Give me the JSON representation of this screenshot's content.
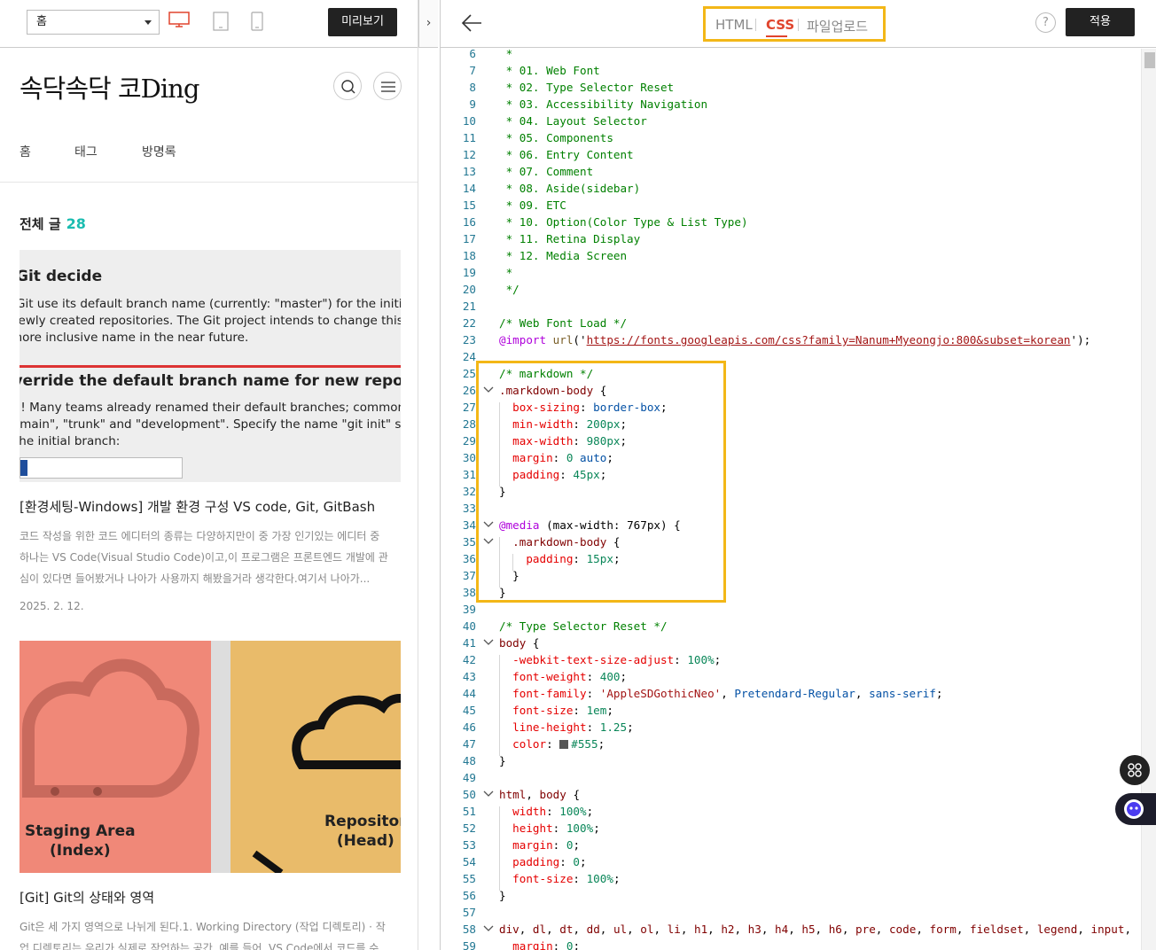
{
  "toolbar": {
    "page_select_value": "홈",
    "preview_label": "미리보기",
    "collapse_icon": "›"
  },
  "blog": {
    "title": "속닥속닥 코Ding",
    "nav": [
      "홈",
      "태그",
      "방명록"
    ],
    "all_posts_label": "전체 글",
    "all_posts_count": "28",
    "posts": [
      {
        "thumb_lines": {
          "h1": "Git decide",
          "p1": "Git use its default branch name (currently: \"master\") for the initia",
          "p2": "newly created repositories. The Git project intends to change this d",
          "p3": "more inclusive name in the near future.",
          "h2": "Override the default branch name for new repositories",
          "p4": "!! Many teams already renamed their default branches; common",
          "p5": "\"main\", \"trunk\" and \"development\". Specify the name \"git init\" sho",
          "p6": "the initial branch:"
        },
        "title": "[환경세팅-Windows] 개발 환경 구성 VS code, Git, GitBash",
        "excerpt": "코드 작성을 위한 코드 에디터의 종류는 다양하지만이 중 가장 인기있는 에디터 중 하나는 VS Code(Visual Studio Code)이고,이 프로그램은 프론트엔드 개발에 관심이 있다면 들어봤거나 나아가 사용까지 해봤을거라 생각한다.여기서 나아가...",
        "date": "2025. 2. 12."
      },
      {
        "thumb_labels": {
          "left": "Staging Area\n(Index)",
          "right": "Repositor\n(Head)"
        },
        "title": "[Git] Git의 상태와 영역",
        "excerpt": "Git은 세 가지 영역으로 나뉘게 된다.1. Working Directory (작업 디렉토리) · 작업 디렉토리는 우리가 실제로 작업하는 공간. 예를 들어, VS Code에서 코드를 수"
      }
    ]
  },
  "editor": {
    "tabs": {
      "html": "HTML",
      "css": "CSS",
      "upload": "파일업로드"
    },
    "active_tab": "CSS",
    "help_label": "?",
    "apply_label": "적용",
    "accent_color": "#e0442d",
    "highlight_color": "#f3b717",
    "code_lines": [
      {
        "n": "6",
        "parts": [
          [
            "c",
            " *"
          ]
        ]
      },
      {
        "n": "7",
        "parts": [
          [
            "c",
            " * 01. Web Font"
          ]
        ]
      },
      {
        "n": "8",
        "parts": [
          [
            "c",
            " * 02. Type Selector Reset"
          ]
        ]
      },
      {
        "n": "9",
        "parts": [
          [
            "c",
            " * 03. Accessibility Navigation"
          ]
        ]
      },
      {
        "n": "10",
        "parts": [
          [
            "c",
            " * 04. Layout Selector"
          ]
        ]
      },
      {
        "n": "11",
        "parts": [
          [
            "c",
            " * 05. Components"
          ]
        ]
      },
      {
        "n": "12",
        "parts": [
          [
            "c",
            " * 06. Entry Content"
          ]
        ]
      },
      {
        "n": "13",
        "parts": [
          [
            "c",
            " * 07. Comment"
          ]
        ]
      },
      {
        "n": "14",
        "parts": [
          [
            "c",
            " * 08. Aside(sidebar)"
          ]
        ]
      },
      {
        "n": "15",
        "parts": [
          [
            "c",
            " * 09. ETC"
          ]
        ]
      },
      {
        "n": "16",
        "parts": [
          [
            "c",
            " * 10. Option(Color Type & List Type)"
          ]
        ]
      },
      {
        "n": "17",
        "parts": [
          [
            "c",
            " * 11. Retina Display"
          ]
        ]
      },
      {
        "n": "18",
        "parts": [
          [
            "c",
            " * 12. Media Screen"
          ]
        ]
      },
      {
        "n": "19",
        "parts": [
          [
            "c",
            " *"
          ]
        ]
      },
      {
        "n": "20",
        "parts": [
          [
            "c",
            " */"
          ]
        ]
      },
      {
        "n": "21",
        "parts": []
      },
      {
        "n": "22",
        "parts": [
          [
            "c",
            "/* Web Font Load */"
          ]
        ]
      },
      {
        "n": "23",
        "parts": [
          [
            "at",
            "@import"
          ],
          [
            "plain",
            " "
          ],
          [
            "fn",
            "url"
          ],
          [
            "plain",
            "('"
          ],
          [
            "url",
            "https://fonts.googleapis.com/css?family=Nanum+Myeongjo:800&subset=korean"
          ],
          [
            "plain",
            "');"
          ]
        ]
      },
      {
        "n": "24",
        "parts": []
      },
      {
        "n": "25",
        "parts": [
          [
            "c",
            "/* markdown */"
          ]
        ]
      },
      {
        "n": "26",
        "fold": true,
        "parts": [
          [
            "sel",
            ".markdown-body"
          ],
          [
            "plain",
            " {"
          ]
        ]
      },
      {
        "n": "27",
        "parts": [
          [
            "plain",
            "  "
          ],
          [
            "prop",
            "box-sizing"
          ],
          [
            "plain",
            ": "
          ],
          [
            "val",
            "border-box"
          ],
          [
            "plain",
            ";"
          ]
        ]
      },
      {
        "n": "28",
        "parts": [
          [
            "plain",
            "  "
          ],
          [
            "prop",
            "min-width"
          ],
          [
            "plain",
            ": "
          ],
          [
            "num",
            "200px"
          ],
          [
            "plain",
            ";"
          ]
        ]
      },
      {
        "n": "29",
        "parts": [
          [
            "plain",
            "  "
          ],
          [
            "prop",
            "max-width"
          ],
          [
            "plain",
            ": "
          ],
          [
            "num",
            "980px"
          ],
          [
            "plain",
            ";"
          ]
        ]
      },
      {
        "n": "30",
        "parts": [
          [
            "plain",
            "  "
          ],
          [
            "prop",
            "margin"
          ],
          [
            "plain",
            ": "
          ],
          [
            "num",
            "0"
          ],
          [
            "plain",
            " "
          ],
          [
            "val",
            "auto"
          ],
          [
            "plain",
            ";"
          ]
        ]
      },
      {
        "n": "31",
        "parts": [
          [
            "plain",
            "  "
          ],
          [
            "prop",
            "padding"
          ],
          [
            "plain",
            ": "
          ],
          [
            "num",
            "45px"
          ],
          [
            "plain",
            ";"
          ]
        ]
      },
      {
        "n": "32",
        "parts": [
          [
            "plain",
            "}"
          ]
        ]
      },
      {
        "n": "33",
        "parts": []
      },
      {
        "n": "34",
        "fold": true,
        "parts": [
          [
            "at",
            "@media"
          ],
          [
            "plain",
            " ("
          ],
          [
            "plain",
            "max-width"
          ],
          [
            "plain",
            ": "
          ],
          [
            "plain",
            "767px"
          ],
          [
            "plain",
            ") {"
          ]
        ]
      },
      {
        "n": "35",
        "fold": true,
        "parts": [
          [
            "plain",
            "  "
          ],
          [
            "sel",
            ".markdown-body"
          ],
          [
            "plain",
            " {"
          ]
        ]
      },
      {
        "n": "36",
        "parts": [
          [
            "plain",
            "    "
          ],
          [
            "prop",
            "padding"
          ],
          [
            "plain",
            ": "
          ],
          [
            "num",
            "15px"
          ],
          [
            "plain",
            ";"
          ]
        ]
      },
      {
        "n": "37",
        "parts": [
          [
            "plain",
            "  }"
          ]
        ]
      },
      {
        "n": "38",
        "parts": [
          [
            "plain",
            "}"
          ]
        ]
      },
      {
        "n": "39",
        "parts": []
      },
      {
        "n": "40",
        "parts": [
          [
            "c",
            "/* Type Selector Reset */"
          ]
        ]
      },
      {
        "n": "41",
        "fold": true,
        "parts": [
          [
            "sel",
            "body"
          ],
          [
            "plain",
            " {"
          ]
        ]
      },
      {
        "n": "42",
        "parts": [
          [
            "plain",
            "  "
          ],
          [
            "prop",
            "-webkit-text-size-adjust"
          ],
          [
            "plain",
            ": "
          ],
          [
            "num",
            "100%"
          ],
          [
            "plain",
            ";"
          ]
        ]
      },
      {
        "n": "43",
        "parts": [
          [
            "plain",
            "  "
          ],
          [
            "prop",
            "font-weight"
          ],
          [
            "plain",
            ": "
          ],
          [
            "num",
            "400"
          ],
          [
            "plain",
            ";"
          ]
        ]
      },
      {
        "n": "44",
        "parts": [
          [
            "plain",
            "  "
          ],
          [
            "prop",
            "font-family"
          ],
          [
            "plain",
            ": "
          ],
          [
            "str",
            "'AppleSDGothicNeo'"
          ],
          [
            "plain",
            ", "
          ],
          [
            "val",
            "Pretendard-Regular"
          ],
          [
            "plain",
            ", "
          ],
          [
            "val",
            "sans-serif"
          ],
          [
            "plain",
            ";"
          ]
        ]
      },
      {
        "n": "45",
        "parts": [
          [
            "plain",
            "  "
          ],
          [
            "prop",
            "font-size"
          ],
          [
            "plain",
            ": "
          ],
          [
            "num",
            "1em"
          ],
          [
            "plain",
            ";"
          ]
        ]
      },
      {
        "n": "46",
        "parts": [
          [
            "plain",
            "  "
          ],
          [
            "prop",
            "line-height"
          ],
          [
            "plain",
            ": "
          ],
          [
            "num",
            "1.25"
          ],
          [
            "plain",
            ";"
          ]
        ]
      },
      {
        "n": "47",
        "parts": [
          [
            "plain",
            "  "
          ],
          [
            "prop",
            "color"
          ],
          [
            "plain",
            ": "
          ],
          [
            "swatch",
            ""
          ],
          [
            "num",
            "#555"
          ],
          [
            "plain",
            ";"
          ]
        ]
      },
      {
        "n": "48",
        "parts": [
          [
            "plain",
            "}"
          ]
        ]
      },
      {
        "n": "49",
        "parts": []
      },
      {
        "n": "50",
        "fold": true,
        "parts": [
          [
            "sel",
            "html"
          ],
          [
            "plain",
            ", "
          ],
          [
            "sel",
            "body"
          ],
          [
            "plain",
            " {"
          ]
        ]
      },
      {
        "n": "51",
        "parts": [
          [
            "plain",
            "  "
          ],
          [
            "prop",
            "width"
          ],
          [
            "plain",
            ": "
          ],
          [
            "num",
            "100%"
          ],
          [
            "plain",
            ";"
          ]
        ]
      },
      {
        "n": "52",
        "parts": [
          [
            "plain",
            "  "
          ],
          [
            "prop",
            "height"
          ],
          [
            "plain",
            ": "
          ],
          [
            "num",
            "100%"
          ],
          [
            "plain",
            ";"
          ]
        ]
      },
      {
        "n": "53",
        "parts": [
          [
            "plain",
            "  "
          ],
          [
            "prop",
            "margin"
          ],
          [
            "plain",
            ": "
          ],
          [
            "num",
            "0"
          ],
          [
            "plain",
            ";"
          ]
        ]
      },
      {
        "n": "54",
        "parts": [
          [
            "plain",
            "  "
          ],
          [
            "prop",
            "padding"
          ],
          [
            "plain",
            ": "
          ],
          [
            "num",
            "0"
          ],
          [
            "plain",
            ";"
          ]
        ]
      },
      {
        "n": "55",
        "parts": [
          [
            "plain",
            "  "
          ],
          [
            "prop",
            "font-size"
          ],
          [
            "plain",
            ": "
          ],
          [
            "num",
            "100%"
          ],
          [
            "plain",
            ";"
          ]
        ]
      },
      {
        "n": "56",
        "parts": [
          [
            "plain",
            "}"
          ]
        ]
      },
      {
        "n": "57",
        "parts": []
      },
      {
        "n": "58",
        "fold": true,
        "parts": [
          [
            "sel",
            "div"
          ],
          [
            "plain",
            ", "
          ],
          [
            "sel",
            "dl"
          ],
          [
            "plain",
            ", "
          ],
          [
            "sel",
            "dt"
          ],
          [
            "plain",
            ", "
          ],
          [
            "sel",
            "dd"
          ],
          [
            "plain",
            ", "
          ],
          [
            "sel",
            "ul"
          ],
          [
            "plain",
            ", "
          ],
          [
            "sel",
            "ol"
          ],
          [
            "plain",
            ", "
          ],
          [
            "sel",
            "li"
          ],
          [
            "plain",
            ", "
          ],
          [
            "sel",
            "h1"
          ],
          [
            "plain",
            ", "
          ],
          [
            "sel",
            "h2"
          ],
          [
            "plain",
            ", "
          ],
          [
            "sel",
            "h3"
          ],
          [
            "plain",
            ", "
          ],
          [
            "sel",
            "h4"
          ],
          [
            "plain",
            ", "
          ],
          [
            "sel",
            "h5"
          ],
          [
            "plain",
            ", "
          ],
          [
            "sel",
            "h6"
          ],
          [
            "plain",
            ", "
          ],
          [
            "sel",
            "pre"
          ],
          [
            "plain",
            ", "
          ],
          [
            "sel",
            "code"
          ],
          [
            "plain",
            ", "
          ],
          [
            "sel",
            "form"
          ],
          [
            "plain",
            ", "
          ],
          [
            "sel",
            "fieldset"
          ],
          [
            "plain",
            ", "
          ],
          [
            "sel",
            "legend"
          ],
          [
            "plain",
            ", "
          ],
          [
            "sel",
            "input"
          ],
          [
            "plain",
            ","
          ]
        ]
      },
      {
        "n": "59",
        "parts": [
          [
            "plain",
            "  "
          ],
          [
            "prop",
            "margin"
          ],
          [
            "plain",
            ": "
          ],
          [
            "num",
            "0"
          ],
          [
            "plain",
            ";"
          ]
        ]
      }
    ]
  }
}
